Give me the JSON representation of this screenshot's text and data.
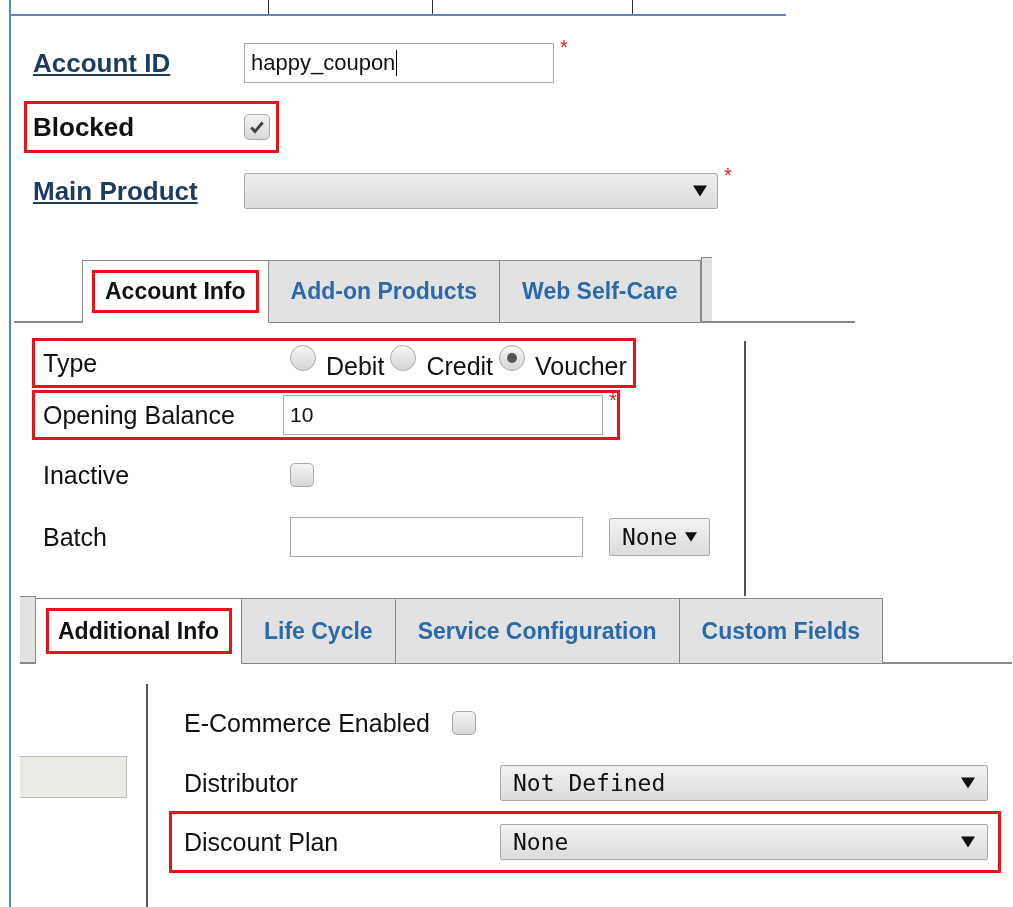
{
  "header_fields": [
    {
      "label": "Account ID",
      "kind": "text",
      "value": "happy_coupon",
      "required_mark": "*",
      "highlighted": false
    },
    {
      "label": "Blocked",
      "kind": "checkbox",
      "checked": true,
      "highlighted": true
    },
    {
      "label": "Main Product",
      "kind": "select",
      "required_mark": "*",
      "highlighted": false
    }
  ],
  "tabs": [
    {
      "label": "Account Info",
      "selected": true,
      "highlighted": true
    },
    {
      "label": "Add-on Products",
      "selected": false,
      "highlighted": false
    },
    {
      "label": "Web Self-Care",
      "selected": false,
      "highlighted": false
    }
  ],
  "account_info": {
    "fields": [
      {
        "label": "Type",
        "kind": "radio",
        "highlighted": true,
        "options": [
          {
            "label": "Debit",
            "selected": false
          },
          {
            "label": "Credit",
            "selected": false
          },
          {
            "label": "Voucher",
            "selected": true
          }
        ]
      },
      {
        "label": "Opening Balance",
        "kind": "text",
        "value": "10",
        "required_mark": "*",
        "highlighted": true
      },
      {
        "label": "Inactive",
        "kind": "checkbox",
        "checked": false,
        "highlighted": false
      },
      {
        "label": "Batch",
        "kind": "text_select",
        "select_value": "None",
        "highlighted": false
      }
    ]
  },
  "tabs_2": [
    {
      "label": "Additional Info",
      "selected": true,
      "highlighted": true
    },
    {
      "label": "Life Cycle",
      "selected": false,
      "highlighted": false
    },
    {
      "label": "Service Configuration",
      "selected": false,
      "highlighted": false
    },
    {
      "label": "Custom Fields",
      "selected": false,
      "highlighted": false
    }
  ],
  "additional_info": {
    "fields": [
      {
        "label": "E-Commerce Enabled",
        "kind": "checkbox",
        "checked": false,
        "highlighted": false
      },
      {
        "label": "Distributor",
        "kind": "select",
        "value": "Not Defined",
        "highlighted": false
      },
      {
        "label": "Discount Plan",
        "kind": "select",
        "value": "None",
        "highlighted": true
      }
    ]
  }
}
